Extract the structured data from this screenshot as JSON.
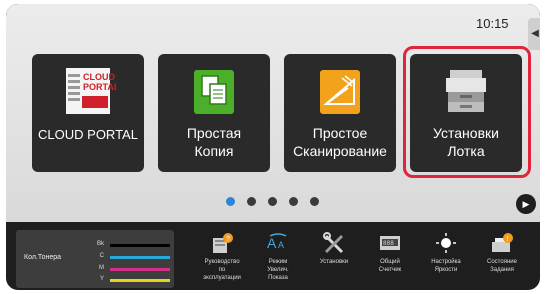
{
  "status": {
    "time": "10:15",
    "side_tab_arrow": "◀"
  },
  "apps": [
    {
      "label_lines": [
        "CLOUD PORTAL"
      ],
      "icon": "cloud-portal-logo-icon",
      "logo_text": [
        "CLOUD",
        "PORTAL"
      ]
    },
    {
      "label_lines": [
        "Простая",
        "Копия"
      ],
      "icon": "copy-icon"
    },
    {
      "label_lines": [
        "Простое",
        "Сканирование"
      ],
      "icon": "scan-icon"
    },
    {
      "label_lines": [
        "Установки",
        "Лотка"
      ],
      "icon": "printer-tray-icon",
      "highlighted": true
    }
  ],
  "pager": {
    "pages": 5,
    "active": 0
  },
  "toner": {
    "title": "Кол.Тонера",
    "rows": [
      {
        "key": "Bk",
        "color": "#000000",
        "level": 1.0
      },
      {
        "key": "C",
        "color": "#2aa8d8",
        "level": 1.0
      },
      {
        "key": "M",
        "color": "#d0308a",
        "level": 1.0
      },
      {
        "key": "Y",
        "color": "#e8d21c",
        "level": 1.0
      }
    ]
  },
  "bottom": [
    {
      "lines": [
        "Руководство",
        "по",
        "эксплуатации"
      ],
      "icon": "manual-icon"
    },
    {
      "lines": [
        "Режим",
        "Увелич.",
        "Показа"
      ],
      "icon": "zoom-display-icon"
    },
    {
      "lines": [
        "Установки"
      ],
      "icon": "settings-tools-icon"
    },
    {
      "lines": [
        "Общий",
        "Счетчик"
      ],
      "icon": "counter-icon"
    },
    {
      "lines": [
        "Настройка",
        "Яркости"
      ],
      "icon": "brightness-icon"
    },
    {
      "lines": [
        "Состояние",
        "Задания"
      ],
      "icon": "job-status-icon"
    }
  ],
  "colors": {
    "highlight": "#e0243b",
    "accent": "#2b87d6"
  }
}
